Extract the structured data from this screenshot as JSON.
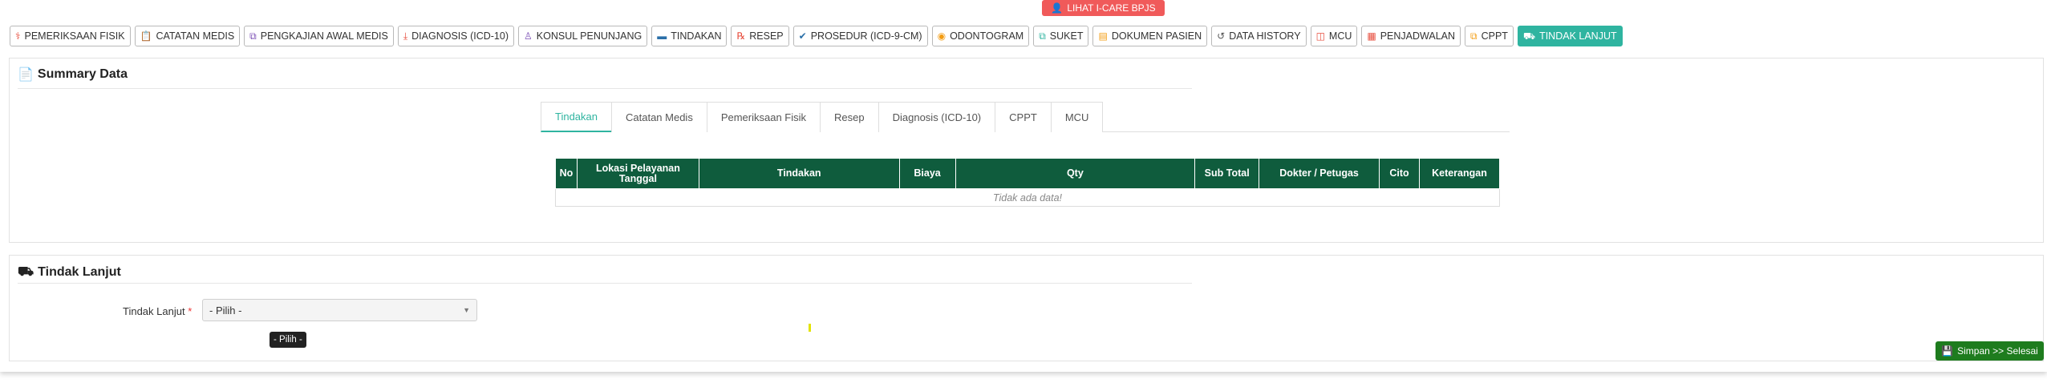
{
  "top_button": {
    "label": "LIHAT I-CARE BPJS",
    "icon": "user-icon"
  },
  "nav": [
    {
      "label": "PEMERIKSAAN FISIK",
      "icon": "stethoscope-icon",
      "icon_color": "#e74c3c",
      "active": false
    },
    {
      "label": "CATATAN MEDIS",
      "icon": "clipboard-icon",
      "icon_color": "#f39c12",
      "active": false
    },
    {
      "label": "PENGKAJIAN AWAL MEDIS",
      "icon": "copy-icon",
      "icon_color": "#7b4fb5",
      "active": false
    },
    {
      "label": "DIAGNOSIS (ICD-10)",
      "icon": "download-icon",
      "icon_color": "#e74c3c",
      "active": false
    },
    {
      "label": "KONSUL PENUNJANG",
      "icon": "user-md-icon",
      "icon_color": "#7b4fb5",
      "active": false
    },
    {
      "label": "TINDAKAN",
      "icon": "bed-icon",
      "icon_color": "#2a6fa8",
      "active": false
    },
    {
      "label": "RESEP",
      "icon": "prescription-icon",
      "icon_color": "#e74c3c",
      "active": false
    },
    {
      "label": "PROSEDUR (ICD-9-CM)",
      "icon": "check-icon",
      "icon_color": "#2a6fa8",
      "active": false
    },
    {
      "label": "ODONTOGRAM",
      "icon": "tooth-icon",
      "icon_color": "#f39c12",
      "active": false
    },
    {
      "label": "SUKET",
      "icon": "files-icon",
      "icon_color": "#2fb4a0",
      "active": false
    },
    {
      "label": "DOKUMEN PASIEN",
      "icon": "document-icon",
      "icon_color": "#f39c12",
      "active": false
    },
    {
      "label": "DATA HISTORY",
      "icon": "history-icon",
      "icon_color": "#555555",
      "active": false
    },
    {
      "label": "MCU",
      "icon": "file-medical-icon",
      "icon_color": "#e74c3c",
      "active": false
    },
    {
      "label": "PENJADWALAN",
      "icon": "calendar-icon",
      "icon_color": "#e74c3c",
      "active": false
    },
    {
      "label": "CPPT",
      "icon": "copy-icon",
      "icon_color": "#f39c12",
      "active": false
    },
    {
      "label": "TINDAK LANJUT",
      "icon": "truck-icon",
      "icon_color": "#ffffff",
      "active": true
    }
  ],
  "summary": {
    "title": "Summary Data",
    "tabs": [
      {
        "label": "Tindakan",
        "active": true
      },
      {
        "label": "Catatan Medis",
        "active": false
      },
      {
        "label": "Pemeriksaan Fisik",
        "active": false
      },
      {
        "label": "Resep",
        "active": false
      },
      {
        "label": "Diagnosis (ICD-10)",
        "active": false
      },
      {
        "label": "CPPT",
        "active": false
      },
      {
        "label": "MCU",
        "active": false
      }
    ],
    "table": {
      "headers": [
        "No",
        "Lokasi Pelayanan Tanggal",
        "Tindakan",
        "Biaya",
        "Qty",
        "Sub Total",
        "Dokter / Petugas",
        "Cito",
        "Keterangan"
      ],
      "empty_text": "Tidak ada data!"
    }
  },
  "tindak_lanjut": {
    "title": "Tindak Lanjut",
    "label": "Tindak Lanjut",
    "required_mark": "*",
    "select_value": "- Pilih -",
    "tooltip": "- Pilih -"
  },
  "save_button": {
    "label": "Simpan >> Selesai",
    "icon": "save-icon"
  },
  "colors": {
    "accent": "#2fb4a0",
    "header_green": "#0f5c3d",
    "save_green": "#1e7c1e",
    "danger": "#f05a5a"
  }
}
